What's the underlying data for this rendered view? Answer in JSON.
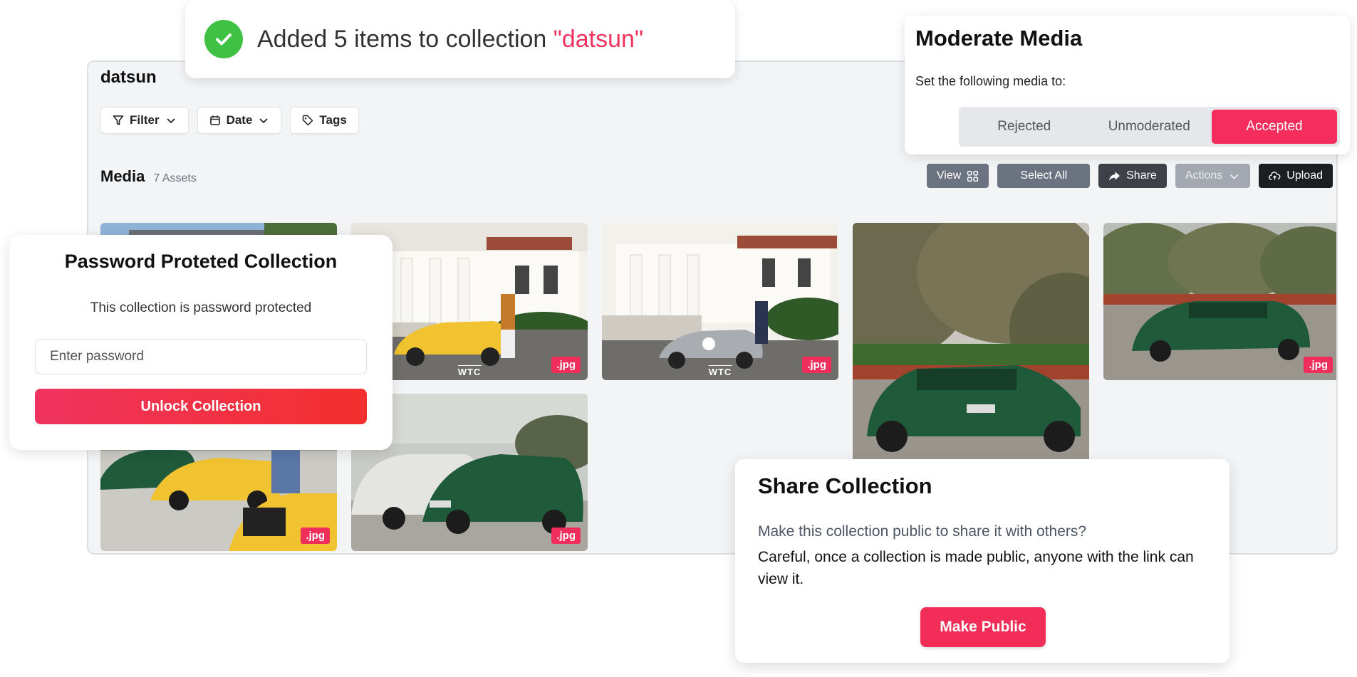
{
  "toast": {
    "message": "Added 5 items to collection ",
    "collection": "\"datsun\"",
    "status_color": "#3fc144"
  },
  "app": {
    "title": "datsun",
    "filters": [
      {
        "label": "Filter",
        "icon": "filter-icon"
      },
      {
        "label": "Date",
        "icon": "calendar-icon"
      },
      {
        "label": "Tags",
        "icon": "tag-icon"
      }
    ],
    "media": {
      "title": "Media",
      "count": "7 Assets"
    },
    "toolbar": {
      "view": "View",
      "select_all": "Select All",
      "share": "Share",
      "actions": "Actions",
      "upload": "Upload"
    },
    "tiles": [
      {
        "ext": ".jpg",
        "watermark": "WTC",
        "subject": "yellow datsun with man at mansion"
      },
      {
        "ext": ".jpg",
        "watermark": "WTC",
        "subject": "silver racing datsun at mansion"
      },
      {
        "ext": "",
        "subject": "green datsun rear under trees"
      },
      {
        "ext": ".jpg",
        "subject": "green datsun on gravel"
      },
      {
        "ext": ".jpg",
        "subject": "yellow and green sports cars"
      },
      {
        "ext": ".jpg",
        "subject": "green datsun and classic cars"
      }
    ]
  },
  "moderate": {
    "title": "Moderate Media",
    "subtitle": "Set the following media to:",
    "options": [
      "Rejected",
      "Unmoderated",
      "Accepted"
    ],
    "selected": "Accepted",
    "accent": "#f42d5c"
  },
  "password": {
    "title": "Password Proteted Collection",
    "description": "This collection is password protected",
    "placeholder": "Enter password",
    "button": "Unlock Collection"
  },
  "share": {
    "title": "Share Collection",
    "question": "Make this collection public to share it with others?",
    "warning": "Careful, once a collection is made public, anyone with the link can view it.",
    "button": "Make Public"
  }
}
